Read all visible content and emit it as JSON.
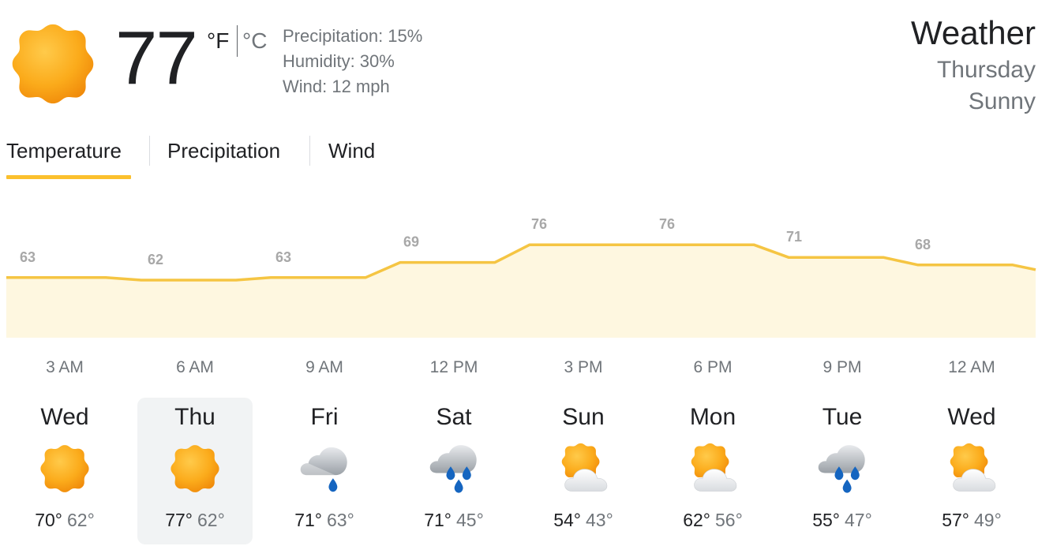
{
  "current": {
    "temperature": "77",
    "unit_f": "°F",
    "unit_c": "°C",
    "icon": "sunny-icon",
    "precipitation": "Precipitation: 15%",
    "humidity": "Humidity: 30%",
    "wind": "Wind: 12 mph"
  },
  "header": {
    "title": "Weather",
    "day": "Thursday",
    "condition": "Sunny"
  },
  "tabs": [
    {
      "label": "Temperature",
      "selected": true
    },
    {
      "label": "Precipitation",
      "selected": false
    },
    {
      "label": "Wind",
      "selected": false
    }
  ],
  "colors": {
    "accent": "#fbc02d",
    "chart_line": "#f5c543",
    "chart_fill": "#fef7e0"
  },
  "chart_data": {
    "type": "area",
    "x": [
      "3 AM",
      "6 AM",
      "9 AM",
      "12 PM",
      "3 PM",
      "6 PM",
      "9 PM",
      "12 AM"
    ],
    "values": [
      63,
      62,
      63,
      69,
      76,
      76,
      71,
      68
    ],
    "grid": false
  },
  "hours": [
    "3 AM",
    "6 AM",
    "9 AM",
    "12 PM",
    "3 PM",
    "6 PM",
    "9 PM",
    "12 AM"
  ],
  "days": [
    {
      "name": "Wed",
      "icon": "sunny-icon",
      "high": "70°",
      "low": "62°",
      "selected": false
    },
    {
      "name": "Thu",
      "icon": "sunny-icon",
      "high": "77°",
      "low": "62°",
      "selected": true
    },
    {
      "name": "Fri",
      "icon": "light-rain-icon",
      "high": "71°",
      "low": "63°",
      "selected": false
    },
    {
      "name": "Sat",
      "icon": "rain-icon",
      "high": "71°",
      "low": "45°",
      "selected": false
    },
    {
      "name": "Sun",
      "icon": "partly-cloudy-icon",
      "high": "54°",
      "low": "43°",
      "selected": false
    },
    {
      "name": "Mon",
      "icon": "partly-cloudy-icon",
      "high": "62°",
      "low": "56°",
      "selected": false
    },
    {
      "name": "Tue",
      "icon": "rain-icon",
      "high": "55°",
      "low": "47°",
      "selected": false
    },
    {
      "name": "Wed",
      "icon": "partly-cloudy-icon",
      "high": "57°",
      "low": "49°",
      "selected": false
    }
  ]
}
